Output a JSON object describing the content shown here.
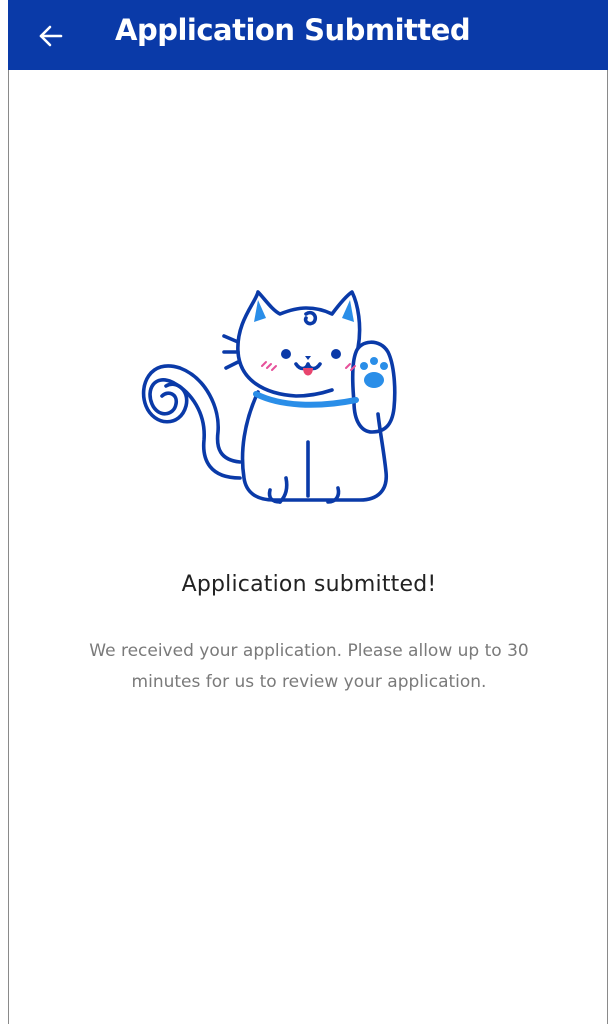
{
  "app_bar": {
    "title": "Application Submitted",
    "back_icon": "arrow-left-icon",
    "background": "#0a3aa8"
  },
  "illustration": {
    "icon": "waving-cat-icon",
    "line_color": "#0a3aa8",
    "accent_color": "#2a8ee8",
    "blush_color": "#e6519a",
    "tongue_color": "#e8456e"
  },
  "content": {
    "headline": "Application submitted!",
    "message": "We received your application. Please allow up to 30 minutes for us to review your application."
  }
}
